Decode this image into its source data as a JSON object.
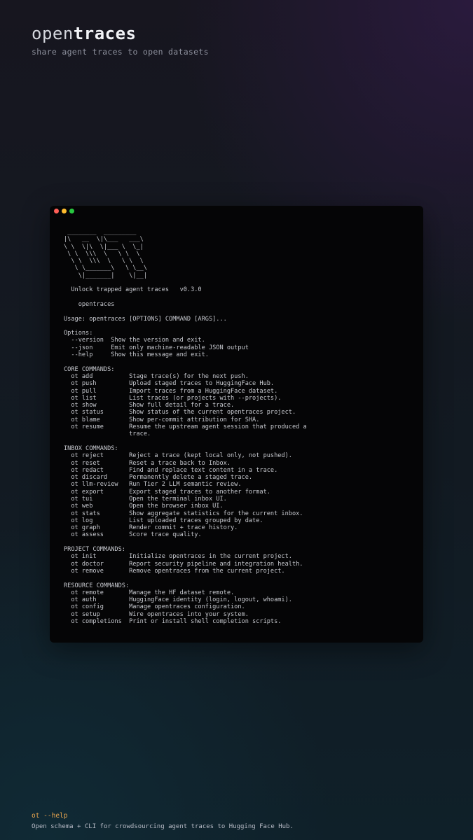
{
  "header": {
    "brand_light": "open",
    "brand_bold": "traces",
    "tagline": "share agent traces to open datasets"
  },
  "terminal": {
    "window_controls": [
      "close",
      "minimize",
      "maximize"
    ],
    "lines": [
      " ________  _________ ",
      "|\\   __  \\|\\___   ___\\",
      "\\ \\  \\|\\  \\|___ \\  \\_|",
      " \\ \\  \\\\\\  \\   \\ \\  \\ ",
      "  \\ \\  \\\\\\  \\   \\ \\  \\",
      "   \\ \\_______\\   \\ \\__\\",
      "    \\|_______|    \\|__|",
      "",
      "  Unlock trapped agent traces   v0.3.0",
      "",
      "    opentraces",
      "",
      "Usage: opentraces [OPTIONS] COMMAND [ARGS]...",
      "",
      "Options:",
      "  --version  Show the version and exit.",
      "  --json     Emit only machine-readable JSON output",
      "  --help     Show this message and exit.",
      "",
      "CORE COMMANDS:",
      "  ot add          Stage trace(s) for the next push.",
      "  ot push         Upload staged traces to HuggingFace Hub.",
      "  ot pull         Import traces from a HuggingFace dataset.",
      "  ot list         List traces (or projects with --projects).",
      "  ot show         Show full detail for a trace.",
      "  ot status       Show status of the current opentraces project.",
      "  ot blame        Show per-commit attribution for SHA.",
      "  ot resume       Resume the upstream agent session that produced a",
      "                  trace.",
      "",
      "INBOX COMMANDS:",
      "  ot reject       Reject a trace (kept local only, not pushed).",
      "  ot reset        Reset a trace back to Inbox.",
      "  ot redact       Find and replace text content in a trace.",
      "  ot discard      Permanently delete a staged trace.",
      "  ot llm-review   Run Tier 2 LLM semantic review.",
      "  ot export       Export staged traces to another format.",
      "  ot tui          Open the terminal inbox UI.",
      "  ot web          Open the browser inbox UI.",
      "  ot stats        Show aggregate statistics for the current inbox.",
      "  ot log          List uploaded traces grouped by date.",
      "  ot graph        Render commit + trace history.",
      "  ot assess       Score trace quality.",
      "",
      "PROJECT COMMANDS:",
      "  ot init         Initialize opentraces in the current project.",
      "  ot doctor       Report security pipeline and integration health.",
      "  ot remove       Remove opentraces from the current project.",
      "",
      "RESOURCE COMMANDS:",
      "  ot remote       Manage the HF dataset remote.",
      "  ot auth         HuggingFace identity (login, logout, whoami).",
      "  ot config       Manage opentraces configuration.",
      "  ot setup        Wire opentraces into your system.",
      "  ot completions  Print or install shell completion scripts."
    ]
  },
  "footer": {
    "command": "ot --help",
    "description": "Open schema + CLI for crowdsourcing agent traces to Hugging Face Hub."
  },
  "colors": {
    "accent": "#e6a44e",
    "terminal_bg": "#050506",
    "close": "#ff5f57",
    "minimize": "#febc2e",
    "maximize": "#28c840"
  }
}
